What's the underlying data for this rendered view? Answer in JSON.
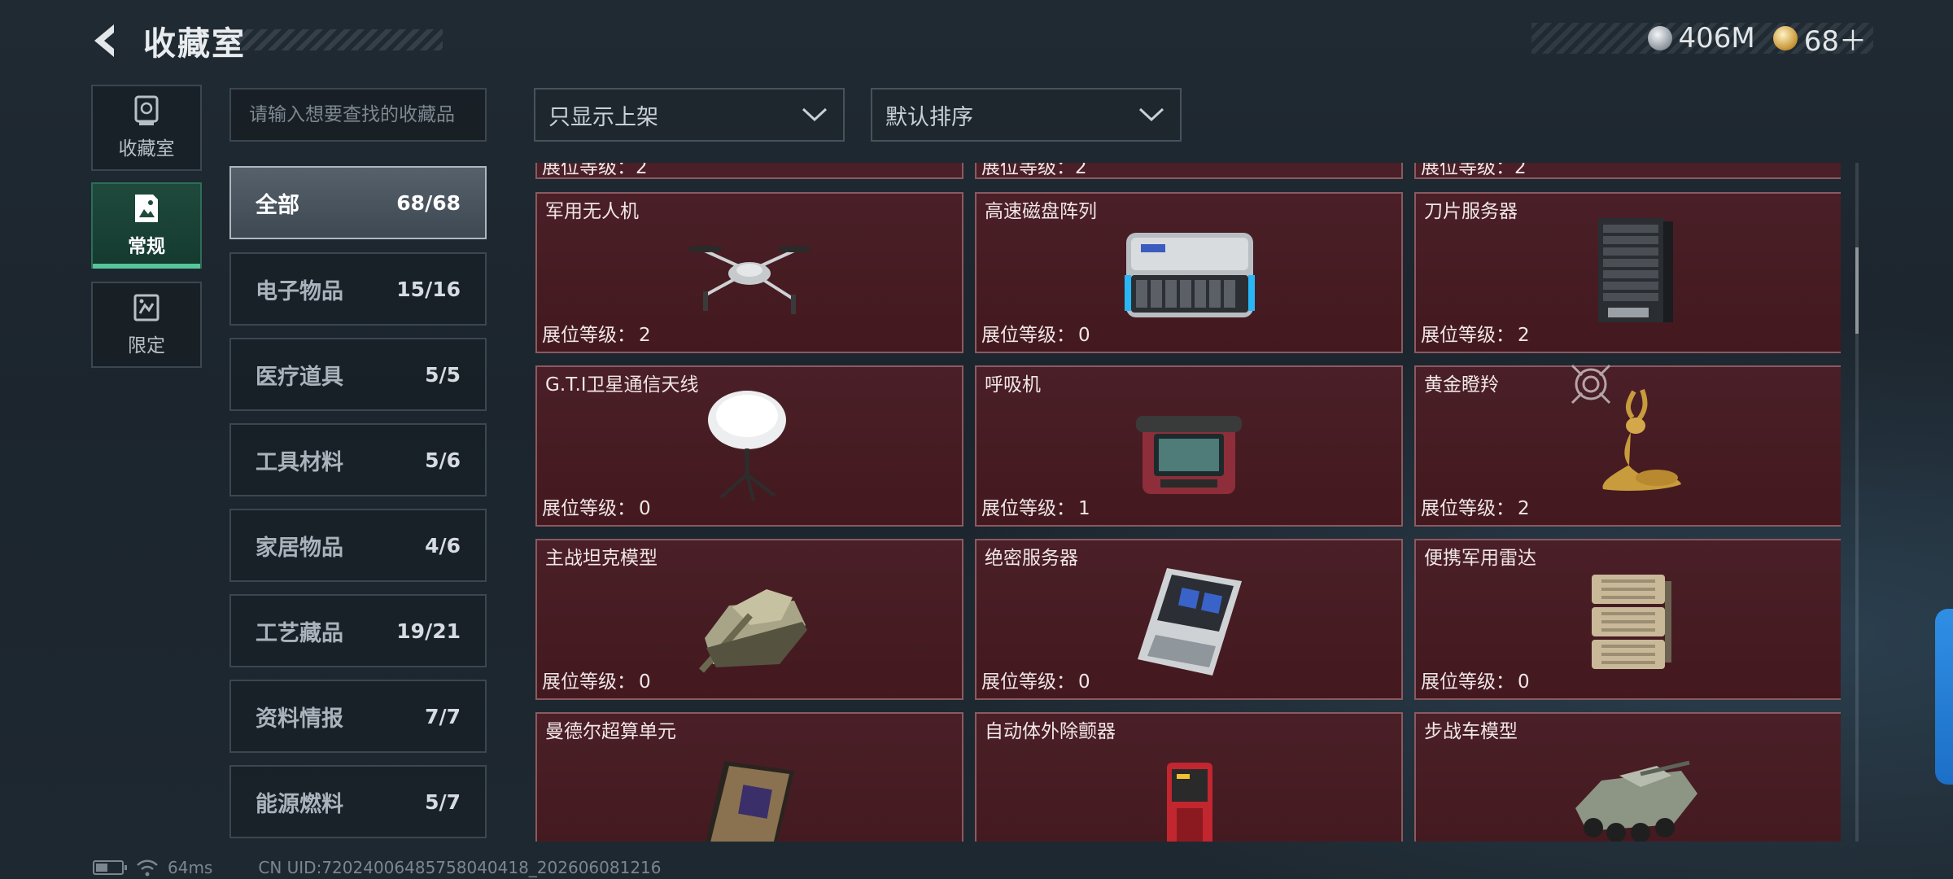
{
  "header": {
    "title": "收藏室",
    "currency": [
      {
        "icon": "silver-coin-icon",
        "value": "406M"
      },
      {
        "icon": "gold-coin-icon",
        "value": "68＋"
      }
    ]
  },
  "nav": [
    {
      "label": "收藏室",
      "icon": "display-case-icon",
      "active": false
    },
    {
      "label": "常规",
      "icon": "image-frame-icon",
      "active": true
    },
    {
      "label": "限定",
      "icon": "limited-card-icon",
      "active": false
    }
  ],
  "search": {
    "placeholder": "请输入想要查找的收藏品"
  },
  "categories": [
    {
      "name": "全部",
      "count": "68/68",
      "active": true
    },
    {
      "name": "电子物品",
      "count": "15/16"
    },
    {
      "name": "医疗道具",
      "count": "5/5"
    },
    {
      "name": "工具材料",
      "count": "5/6"
    },
    {
      "name": "家居物品",
      "count": "4/6"
    },
    {
      "name": "工艺藏品",
      "count": "19/21"
    },
    {
      "name": "资料情报",
      "count": "7/7"
    },
    {
      "name": "能源燃料",
      "count": "5/7"
    }
  ],
  "filters": {
    "display": "只显示上架",
    "sort": "默认排序"
  },
  "level_label": "展位等级：",
  "partial_row": [
    {
      "level": "2"
    },
    {
      "level": "2"
    },
    {
      "level": "2"
    }
  ],
  "items": [
    {
      "name": "军用无人机",
      "level": "2",
      "icon": "drone-icon"
    },
    {
      "name": "高速磁盘阵列",
      "level": "0",
      "icon": "disk-array-icon"
    },
    {
      "name": "刀片服务器",
      "level": "2",
      "icon": "blade-server-icon"
    },
    {
      "name": "G.T.I卫星通信天线",
      "level": "0",
      "icon": "satellite-dish-icon"
    },
    {
      "name": "呼吸机",
      "level": "1",
      "icon": "ventilator-icon"
    },
    {
      "name": "黄金瞪羚",
      "level": "2",
      "icon": "golden-gazelle-icon"
    },
    {
      "name": "主战坦克模型",
      "level": "0",
      "icon": "tank-model-icon"
    },
    {
      "name": "绝密服务器",
      "level": "0",
      "icon": "secret-server-icon"
    },
    {
      "name": "便携军用雷达",
      "level": "0",
      "icon": "portable-radar-icon"
    },
    {
      "name": "曼德尔超算单元",
      "level": "",
      "icon": "supercomputer-unit-icon"
    },
    {
      "name": "自动体外除颤器",
      "level": "",
      "icon": "defibrillator-icon"
    },
    {
      "name": "步战车模型",
      "level": "",
      "icon": "ifv-model-icon"
    }
  ],
  "status": {
    "ping": "64ms",
    "uid": "CN UID:72024006485758040418_202606081216"
  }
}
